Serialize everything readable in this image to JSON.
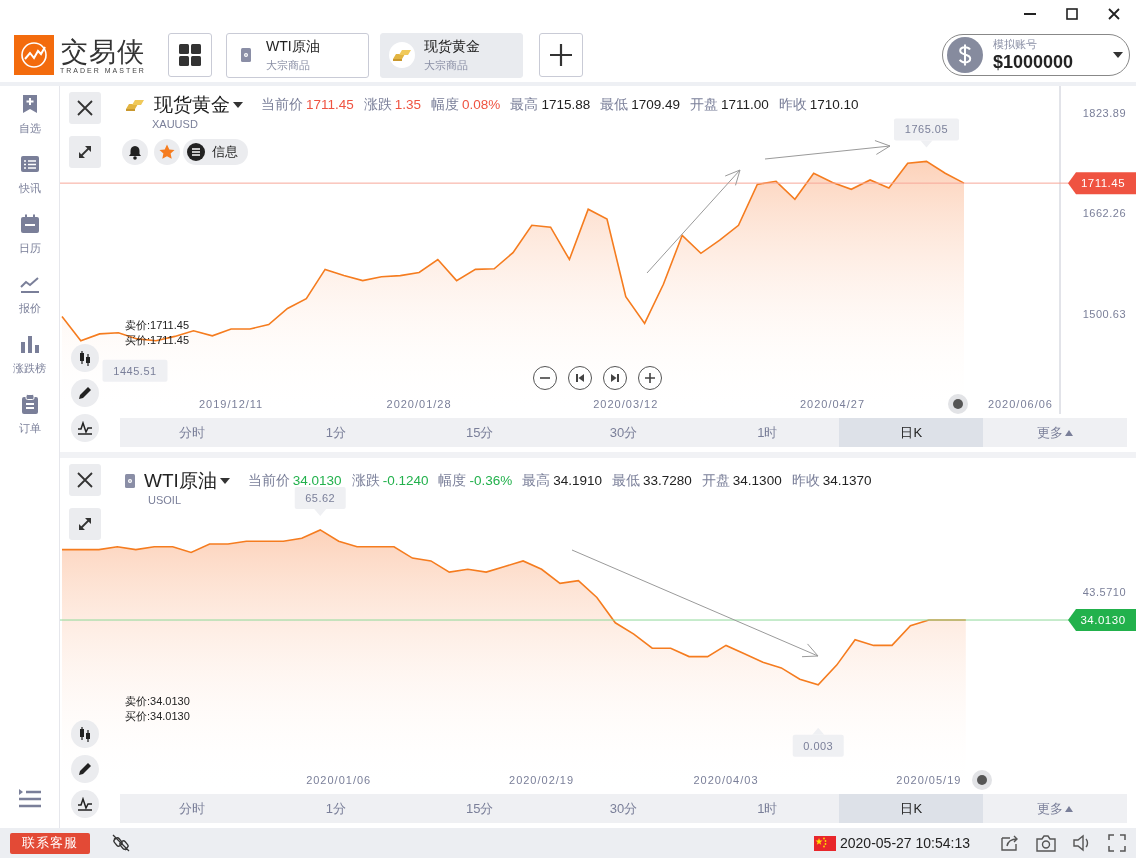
{
  "app": {
    "logo_text": "交易侠",
    "logo_subtitle": "TRADER MASTER"
  },
  "product_tabs": [
    {
      "name": "WTI原油",
      "category": "大宗商品",
      "kind": "oil",
      "selected": false
    },
    {
      "name": "现货黄金",
      "category": "大宗商品",
      "kind": "gold",
      "selected": true
    }
  ],
  "account": {
    "label": "模拟账号",
    "balance": "$1000000"
  },
  "sidebar": {
    "items": [
      {
        "label": "自选",
        "kind": "watchlist"
      },
      {
        "label": "快讯",
        "kind": "news"
      },
      {
        "label": "日历",
        "kind": "calendar"
      },
      {
        "label": "报价",
        "kind": "quotes"
      },
      {
        "label": "涨跌榜",
        "kind": "movers"
      },
      {
        "label": "订单",
        "kind": "orders"
      }
    ]
  },
  "panels": [
    {
      "kind": "gold",
      "name": "现货黄金",
      "symbol": "XAUUSD",
      "rising": true,
      "stats": [
        {
          "label": "当前价",
          "value": "1711.45",
          "colored": true
        },
        {
          "label": "涨跌",
          "value": "1.35",
          "colored": true
        },
        {
          "label": "幅度",
          "value": "0.08%",
          "colored": true
        },
        {
          "label": "最高",
          "value": "1715.88",
          "colored": false
        },
        {
          "label": "最低",
          "value": "1709.49",
          "colored": false
        },
        {
          "label": "开盘",
          "value": "1711.00",
          "colored": false
        },
        {
          "label": "昨收",
          "value": "1710.10",
          "colored": false
        }
      ],
      "toolbar": {
        "favorite": true,
        "info_label": "信息"
      },
      "sell": "卖价:1711.45",
      "buy": "买价:1711.45",
      "zoom_controls": true,
      "price_tag": "1711.45",
      "periods": [
        {
          "label": "分时",
          "selected": false
        },
        {
          "label": "1分",
          "selected": false
        },
        {
          "label": "15分",
          "selected": false
        },
        {
          "label": "30分",
          "selected": false
        },
        {
          "label": "1时",
          "selected": false
        },
        {
          "label": "日K",
          "selected": true
        },
        {
          "label": "更多",
          "kind": "menu",
          "selected": false
        }
      ],
      "chart_data": {
        "type": "area",
        "categories": [
          null,
          null,
          null,
          null,
          null,
          null,
          null,
          null,
          null,
          "2019/12/11",
          null,
          null,
          null,
          null,
          null,
          null,
          null,
          null,
          null,
          "2020/01/28",
          null,
          null,
          null,
          null,
          null,
          null,
          null,
          null,
          null,
          null,
          "2020/03/12",
          null,
          null,
          null,
          null,
          null,
          null,
          null,
          null,
          null,
          null,
          "2020/04/27",
          null,
          null,
          null,
          null,
          null,
          null,
          null,
          null,
          null,
          "2020/06/06",
          null,
          null
        ],
        "values": [
          1496,
          1457,
          1468,
          1470,
          1460,
          1457,
          1464,
          1473,
          1465,
          1476,
          1476,
          1483,
          1509,
          1525,
          1572,
          1562,
          1554,
          1560,
          1562,
          1567,
          1588,
          1554,
          1572,
          1573,
          1599,
          1643,
          1640,
          1588,
          1669,
          1653,
          1528,
          1485,
          1548,
          1627,
          1598,
          1619,
          1643,
          1709,
          1714,
          1685,
          1727,
          1712,
          1701,
          1716,
          1703,
          1743,
          1746,
          1727,
          1711,
          null,
          null,
          null,
          null,
          null
        ],
        "ylim": [
          1339,
          1867.5
        ],
        "yticks": [
          {
            "value": 1823.89,
            "label": "1823.89"
          },
          {
            "value": 1662.26,
            "label": "1662.26"
          },
          {
            "value": 1500.63,
            "label": "1500.63"
          }
        ],
        "annotations": [
          "1765.05",
          "1445.51"
        ]
      }
    },
    {
      "kind": "oil",
      "name": "WTI原油",
      "symbol": "USOIL",
      "rising": false,
      "stats": [
        {
          "label": "当前价",
          "value": "34.0130",
          "colored": true
        },
        {
          "label": "涨跌",
          "value": "-0.1240",
          "colored": true
        },
        {
          "label": "幅度",
          "value": "-0.36%",
          "colored": true
        },
        {
          "label": "最高",
          "value": "34.1910",
          "colored": false
        },
        {
          "label": "最低",
          "value": "33.7280",
          "colored": false
        },
        {
          "label": "开盘",
          "value": "34.1300",
          "colored": false
        },
        {
          "label": "昨收",
          "value": "34.1370",
          "colored": false
        }
      ],
      "sell": "卖价:34.0130",
      "buy": "买价:34.0130",
      "price_tag": "34.0130",
      "periods": [
        {
          "label": "分时",
          "selected": false
        },
        {
          "label": "1分",
          "selected": false
        },
        {
          "label": "15分",
          "selected": false
        },
        {
          "label": "30分",
          "selected": false
        },
        {
          "label": "1时",
          "selected": false
        },
        {
          "label": "日K",
          "selected": true
        },
        {
          "label": "更多",
          "kind": "menu",
          "selected": false
        }
      ],
      "chart": {
        "kind": "area",
        "date_labels": [
          "2020/01/06",
          "2020/02/19",
          "2020/04/03",
          "2020/05/19"
        ],
        "high_label": "65.62",
        "low_label": "0.003",
        "axis_label": "43.5710"
      }
    }
  ],
  "status_bar": {
    "support_button": "联系客服",
    "datetime": "2020-05-27 10:54:13"
  }
}
